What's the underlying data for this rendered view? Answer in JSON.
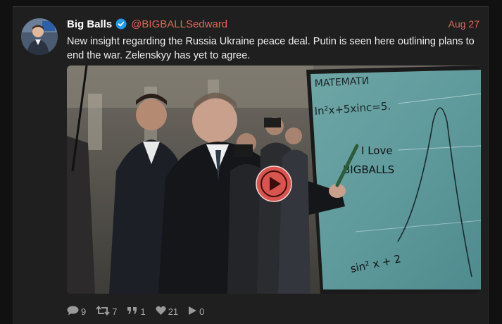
{
  "tweet": {
    "author": {
      "display_name": "Big Balls",
      "handle": "@BIGBALLSedward",
      "verified": true
    },
    "date": "Aug 27",
    "text": "New insight regarding the Russia Ukraine peace deal. Putin is seen here outlining plans to end the war. Zelenskyy has yet to agree.",
    "media": {
      "type": "video",
      "board_text": {
        "header": "MATEMATИ",
        "equation": "In²x+5xinc=5.",
        "line1": "I Love",
        "line2": "BIGBALLS",
        "bottom": "sin² x + 2"
      }
    },
    "actions": {
      "replies": "9",
      "retweets": "7",
      "quotes": "1",
      "likes": "21",
      "views": "0"
    }
  },
  "colors": {
    "accent": "#e0685a",
    "verified": "#1d9bf0",
    "play_button": "#d9534f"
  }
}
